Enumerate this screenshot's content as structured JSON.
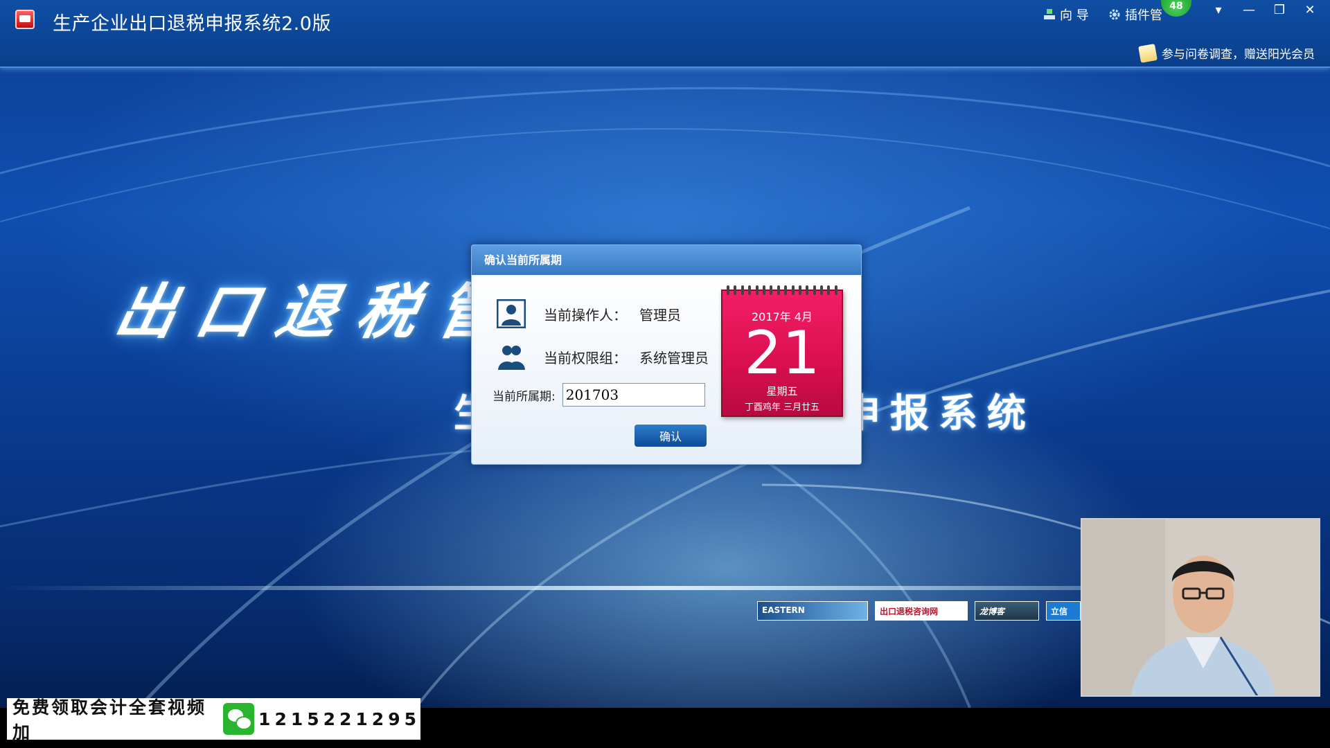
{
  "window": {
    "title": "生产企业出口退税申报系统2.0版",
    "guide_label": "向 导",
    "plugin_label": "插件管",
    "notify_badge": "48",
    "survey_text": "参与问卷调查，赠送阳光会员",
    "controls": {
      "dropdown": "▾",
      "minimize": "—",
      "restore": "❐",
      "close": "✕"
    }
  },
  "banner": {
    "title": "出口退税管理系统",
    "subtitle": "生产企业出口退税申报系统"
  },
  "dialog": {
    "title": "确认当前所属期",
    "operator_label": "当前操作人：",
    "operator_value": "管理员",
    "group_label": "当前权限组：",
    "group_value": "系统管理员",
    "period_label": "当前所属期:",
    "period_value": "201703",
    "confirm_label": "确认"
  },
  "calendar": {
    "year_month": "2017年  4月",
    "day": "21",
    "weekday": "星期五",
    "lunar": "丁酉鸡年  三月廿五"
  },
  "logos": {
    "logo1": "EASTERN",
    "logo2": "出口退税咨询网",
    "logo3": "龙博客",
    "logo4": "立信"
  },
  "promo": {
    "text": "免费领取会计全套视频加",
    "number": "1215221295"
  },
  "colors": {
    "titlebar": "#0c4596",
    "calendar": "#e0145a",
    "dialog_header": "#4a8bd4",
    "button": "#1a5fad"
  }
}
